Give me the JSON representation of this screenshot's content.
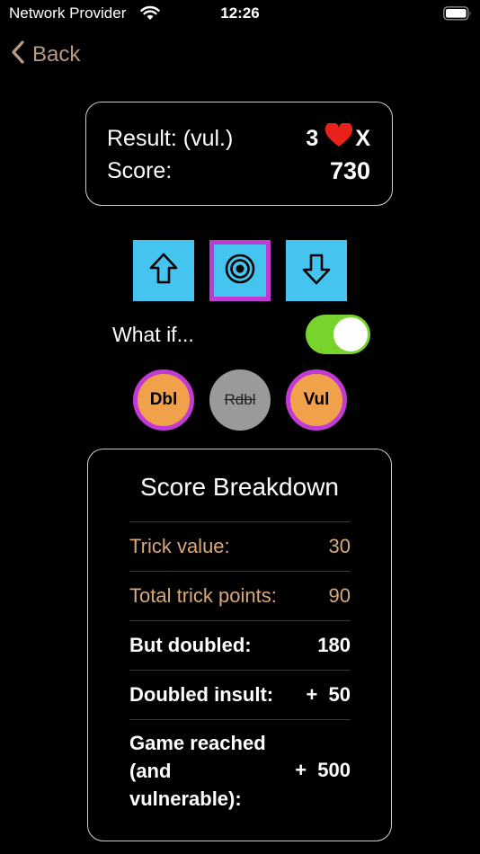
{
  "status_bar": {
    "carrier": "Network Provider",
    "time": "12:26"
  },
  "nav": {
    "back_label": "Back"
  },
  "result": {
    "result_label": "Result: (vul.)",
    "contract_level": "3",
    "contract_suffix": "X",
    "score_label": "Score:",
    "score_value": "730"
  },
  "controls": {
    "whatif_label": "What if...",
    "whatif_on": true,
    "dbl_label": "Dbl",
    "rdbl_label": "Rdbl",
    "vul_label": "Vul"
  },
  "breakdown": {
    "title": "Score Breakdown",
    "rows": [
      {
        "label": "Trick value:",
        "value": "30"
      },
      {
        "label": "Total trick points:",
        "value": "90"
      },
      {
        "label": "But doubled:",
        "value": "180"
      },
      {
        "label": "Doubled insult:",
        "value": "+  50"
      },
      {
        "label": "Game reached (and vulnerable):",
        "value": "+  500"
      }
    ]
  },
  "colors": {
    "accent_blue": "#46c4f0",
    "selection_purple": "#c23ad6",
    "orange": "#f0a14a",
    "toggle_green": "#78d42c",
    "back_tan": "#b69b85",
    "row_tan": "#d9a978",
    "heart_red": "#e8221b"
  }
}
